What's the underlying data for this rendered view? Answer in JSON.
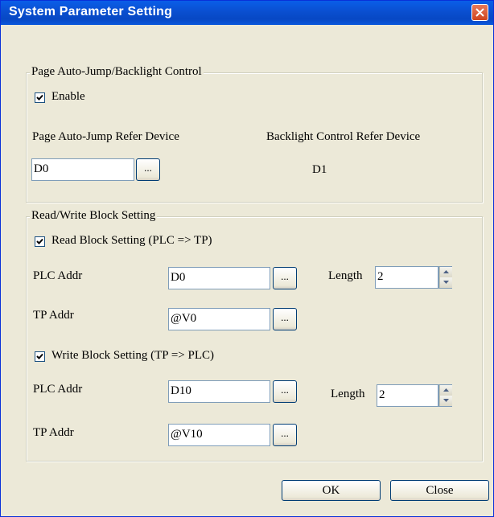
{
  "window": {
    "title": "System Parameter Setting"
  },
  "page_jump": {
    "legend": "Page Auto-Jump/Backlight Control",
    "enable_label": "Enable",
    "enable_checked": true,
    "refer_device_label": "Page Auto-Jump Refer Device",
    "refer_device_value": "D0",
    "browse_label": "...",
    "backlight_label": "Backlight Control Refer Device",
    "backlight_value": "D1"
  },
  "rw_block": {
    "legend": "Read/Write Block Setting",
    "read": {
      "label": "Read Block Setting  (PLC => TP)",
      "checked": true,
      "plc_label": "PLC Addr",
      "plc_value": "D0",
      "tp_label": "TP Addr",
      "tp_value": "@V0",
      "length_label": "Length",
      "length_value": "2"
    },
    "write": {
      "label": "Write Block Setting  (TP => PLC)",
      "checked": true,
      "plc_label": "PLC Addr",
      "plc_value": "D10",
      "tp_label": "TP Addr",
      "tp_value": "@V10",
      "length_label": "Length",
      "length_value": "2"
    },
    "browse_label": "..."
  },
  "buttons": {
    "ok": "OK",
    "close": "Close"
  },
  "colors": {
    "titlebar": "#0a50d4",
    "face": "#ece9d8",
    "close": "#d6502c"
  }
}
